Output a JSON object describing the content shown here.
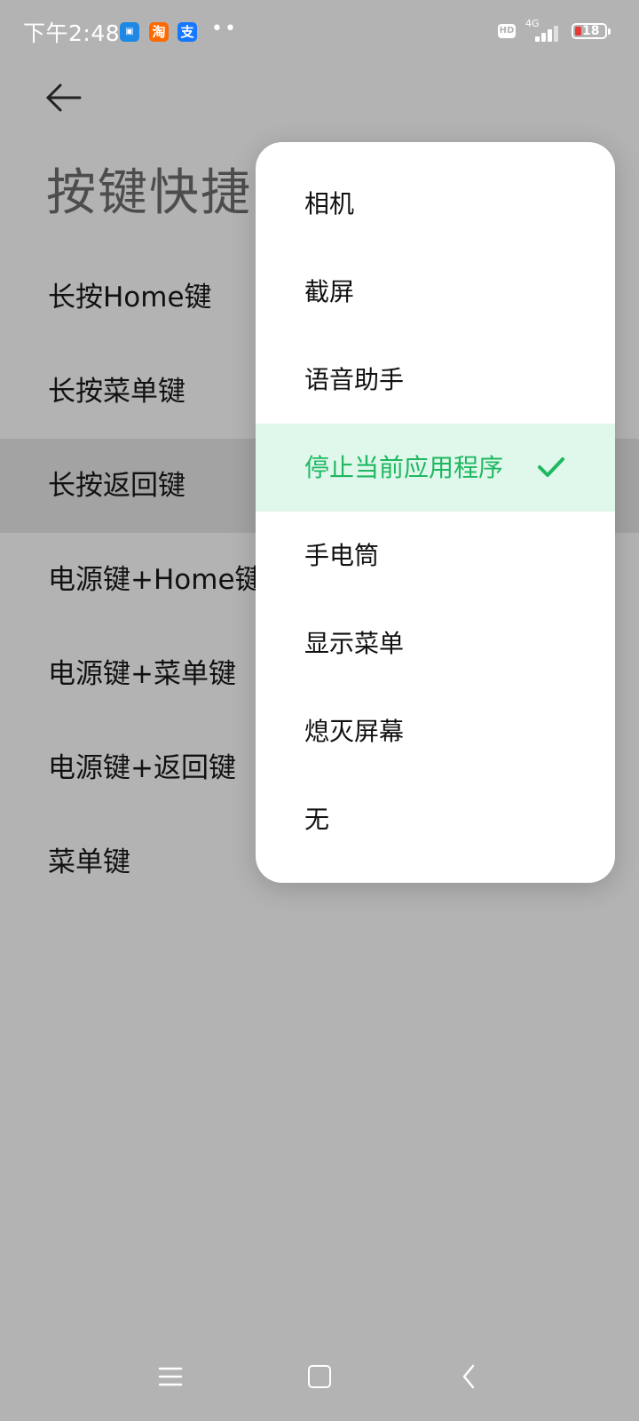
{
  "status_bar": {
    "time": "下午2:48",
    "app_icons": [
      {
        "name": "news-app-icon",
        "glyph": "▣"
      },
      {
        "name": "taobao-icon",
        "glyph": "淘"
      },
      {
        "name": "alipay-icon",
        "glyph": "支"
      }
    ],
    "dots": "••",
    "hd_badge": "HD",
    "network": "4G",
    "battery_level": "18",
    "battery_low_color": "#e53935"
  },
  "header": {
    "back_icon": "arrow-left-icon",
    "title": "按键快捷"
  },
  "settings_items": [
    {
      "label": "长按Home键"
    },
    {
      "label": "长按菜单键"
    },
    {
      "label": "长按返回键",
      "pressed": true
    },
    {
      "label": "电源键+Home键"
    },
    {
      "label": "电源键+菜单键"
    },
    {
      "label": "电源键+返回键"
    },
    {
      "label": "菜单键"
    }
  ],
  "popup_menu": {
    "options": [
      {
        "label": "相机"
      },
      {
        "label": "截屏"
      },
      {
        "label": "语音助手"
      },
      {
        "label": "停止当前应用程序",
        "selected": true
      },
      {
        "label": "手电筒"
      },
      {
        "label": "显示菜单"
      },
      {
        "label": "熄灭屏幕"
      },
      {
        "label": "无"
      }
    ],
    "selected_color": "#1fb861",
    "selected_bg": "#e0f7ec",
    "check_icon": "checkmark-icon"
  },
  "nav_bar": {
    "menu_icon": "menu-lines-icon",
    "home_icon": "home-square-icon",
    "back_icon": "chevron-left-icon"
  },
  "colors": {
    "scrim": "#b3b3b3",
    "pressed_row": "#a3a3a3"
  }
}
